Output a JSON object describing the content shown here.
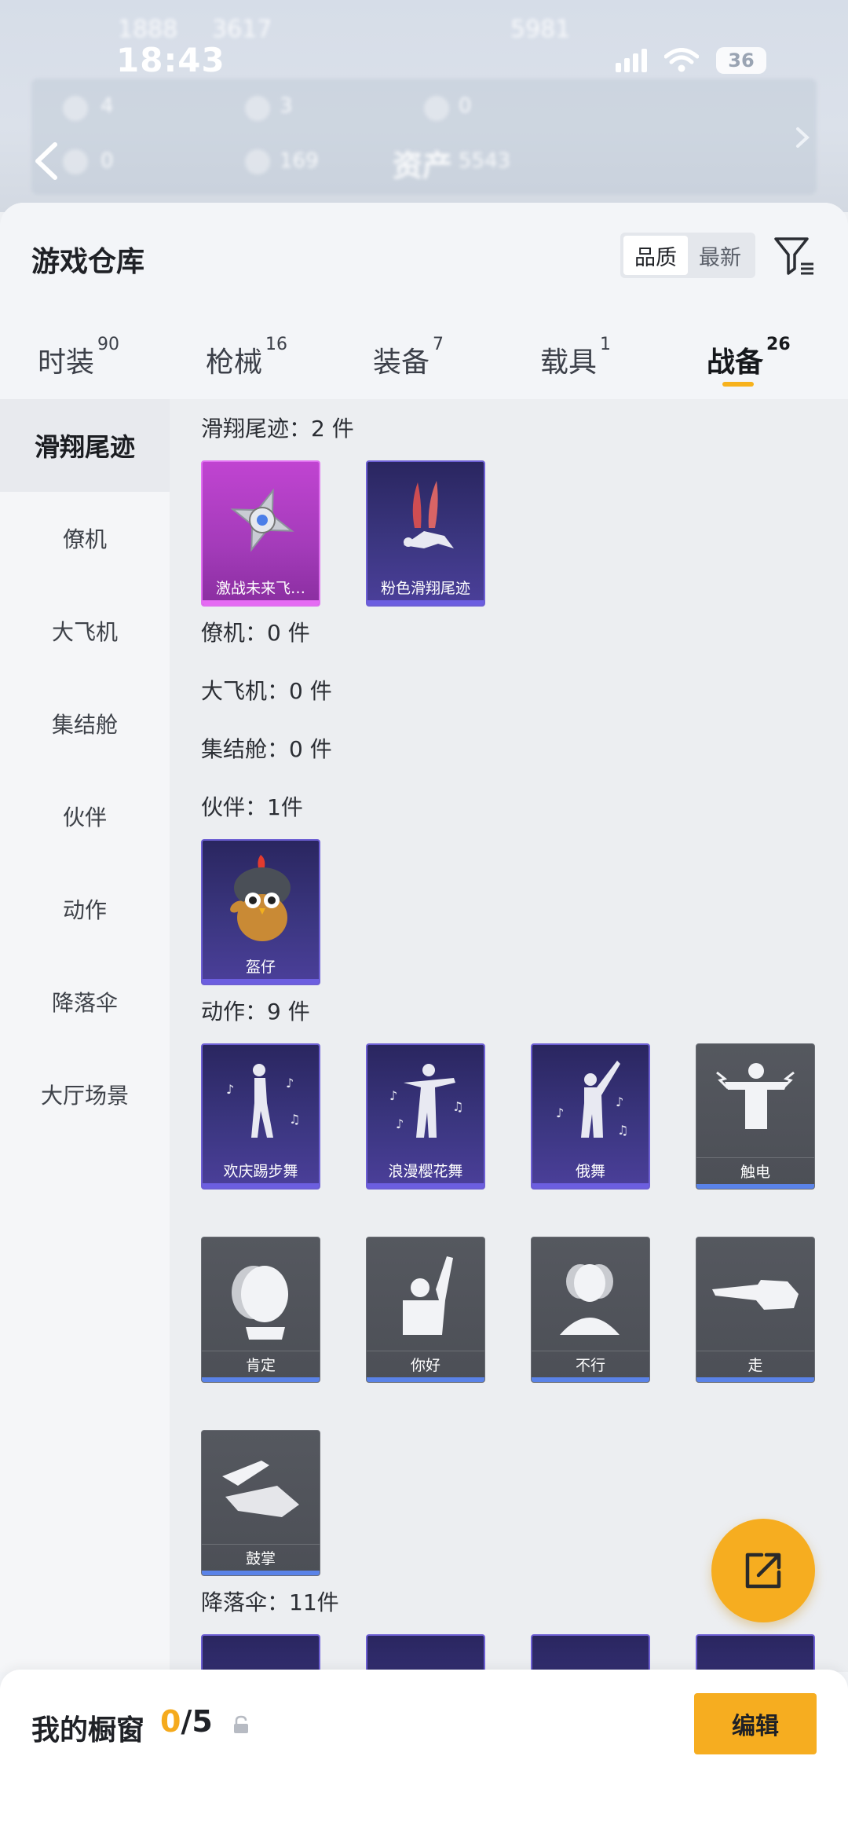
{
  "status_bar": {
    "time": "18:43",
    "battery": "36"
  },
  "background_ghost": {
    "line1_a": "1888",
    "line1_b": "3617",
    "line1_c": "5981",
    "row2_a": "4",
    "row2_b": "3",
    "row2_c": "0",
    "row3_a": "0",
    "row3_b": "169",
    "assets_label": "资产",
    "assets_value": "5543"
  },
  "sheet": {
    "title": "游戏仓库",
    "sort_options": [
      "品质",
      "最新"
    ],
    "active_sort": "品质"
  },
  "tabs": [
    {
      "label": "时装",
      "count": "90"
    },
    {
      "label": "枪械",
      "count": "16"
    },
    {
      "label": "装备",
      "count": "7"
    },
    {
      "label": "载具",
      "count": "1"
    },
    {
      "label": "战备",
      "count": "26"
    }
  ],
  "sidebar": {
    "items": [
      "滑翔尾迹",
      "僚机",
      "大飞机",
      "集结舱",
      "伙伴",
      "动作",
      "降落伞",
      "大厅场景"
    ],
    "active": "滑翔尾迹"
  },
  "sections": {
    "glide": {
      "label": "滑翔尾迹：2 件",
      "items": [
        "激战未来飞…",
        "粉色滑翔尾迹"
      ]
    },
    "wingman": {
      "label": "僚机：0 件"
    },
    "plane": {
      "label": "大飞机：0 件"
    },
    "pod": {
      "label": "集结舱：0 件"
    },
    "partner": {
      "label": "伙伴：1件",
      "items": [
        "盔仔"
      ]
    },
    "emote": {
      "label": "动作：9 件",
      "items": [
        "欢庆踢步舞",
        "浪漫樱花舞",
        "俄舞",
        "触电",
        "肯定",
        "你好",
        "不行",
        "走",
        "鼓掌"
      ]
    },
    "parachute": {
      "label": "降落伞：11件"
    }
  },
  "showcase": {
    "title": "我的橱窗",
    "current": "0",
    "total": "/5",
    "edit_label": "编辑"
  },
  "colors": {
    "accent": "#f6ad20",
    "rare_purple": "#6c5ee0",
    "legendary_pink": "#e56bf3",
    "common_blue": "#5a83e8"
  }
}
